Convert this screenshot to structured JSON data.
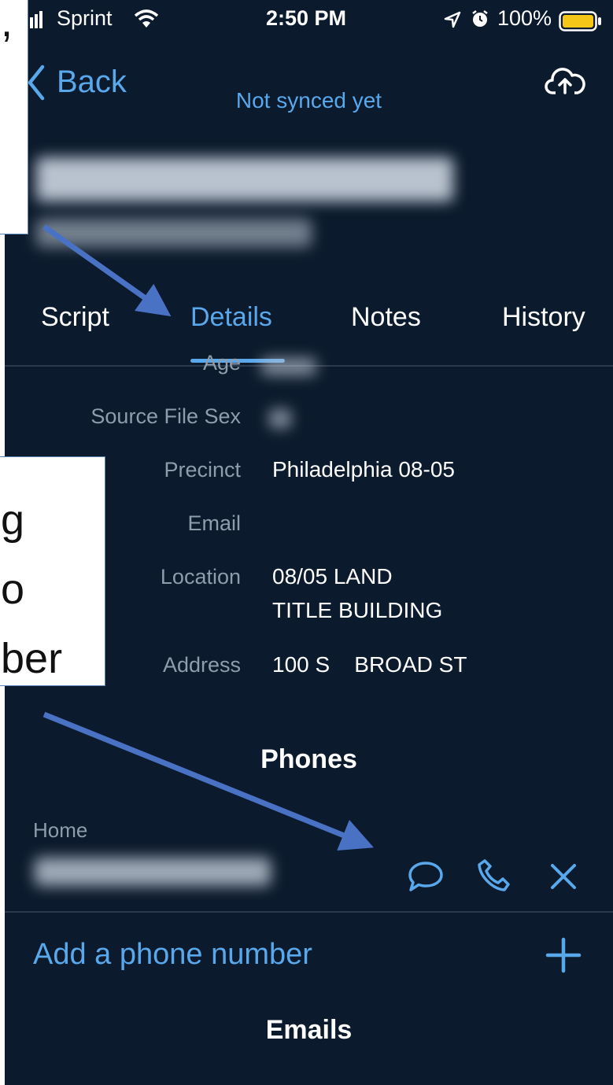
{
  "status_bar": {
    "carrier": "Sprint",
    "time": "2:50 PM",
    "battery": "100%"
  },
  "nav": {
    "back_label": "Back",
    "sync_status": "Not synced yet",
    "icons": [
      "chevron-left-icon",
      "cloud-upload-icon"
    ]
  },
  "tabs": [
    {
      "label": "Script"
    },
    {
      "label": "Details"
    },
    {
      "label": "Notes"
    },
    {
      "label": "History"
    }
  ],
  "details": {
    "age_label": "Age",
    "source_sex_label": "Source File Sex",
    "precinct_label": "Precinct",
    "precinct_value": "Philadelphia 08-05",
    "email_label": "Email",
    "location_label": "Location",
    "location_line1": "08/05 LAND",
    "location_line2": "TITLE BUILDING",
    "address_label": "Address",
    "address_value": "100 S    BROAD ST"
  },
  "phones": {
    "section_title": "Phones",
    "entry_type": "Home",
    "add_label": "Add a phone number",
    "icons": [
      "message-icon",
      "phone-icon",
      "close-icon",
      "plus-icon"
    ]
  },
  "emails": {
    "section_title": "Emails"
  },
  "callouts": {
    "top_fragment": ",",
    "middle_lines": [
      "g",
      "o",
      "ber"
    ]
  },
  "colors": {
    "background": "#0b1a2c",
    "accent": "#5aa8ec",
    "arrow": "#4a72c4",
    "battery": "#f5c518"
  }
}
